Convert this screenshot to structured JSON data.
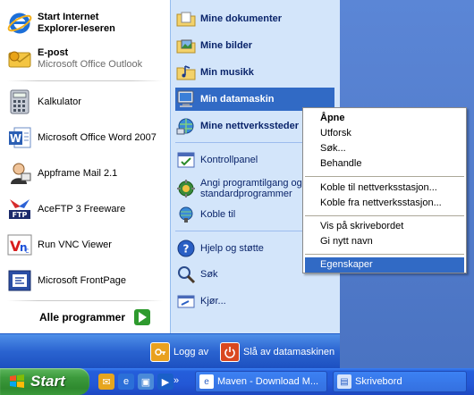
{
  "pinned": [
    {
      "name": "Start Internet Explorer-leseren",
      "line1": "Start Internet",
      "line2": "Explorer-leseren",
      "icon": "internet-explorer-icon"
    },
    {
      "name": "E-post",
      "line1": "E-post",
      "line2": "Microsoft Office Outlook",
      "icon": "outlook-icon"
    }
  ],
  "recent": [
    {
      "label": "Kalkulator",
      "icon": "calculator-icon"
    },
    {
      "label": "Microsoft Office Word 2007",
      "icon": "word-icon"
    },
    {
      "label": "Appframe Mail 2.1",
      "icon": "appframe-mail-icon"
    },
    {
      "label": "AceFTP 3 Freeware",
      "icon": "aceftp-icon"
    },
    {
      "label": "Run VNC Viewer",
      "icon": "vnc-icon"
    },
    {
      "label": "Microsoft FrontPage",
      "icon": "frontpage-icon"
    }
  ],
  "all_programs": "Alle programmer",
  "places": [
    {
      "label": "Mine dokumenter",
      "icon": "my-documents-icon"
    },
    {
      "label": "Mine bilder",
      "icon": "my-pictures-icon"
    },
    {
      "label": "Min musikk",
      "icon": "my-music-icon"
    },
    {
      "label": "Min datamaskin",
      "icon": "my-computer-icon"
    },
    {
      "label": "Mine nettverkssteder",
      "icon": "my-network-icon"
    }
  ],
  "settings": [
    {
      "label": "Kontrollpanel",
      "icon": "control-panel-icon"
    },
    {
      "line1": "Angi programtilgang og",
      "line2": "standardprogrammer",
      "icon": "program-access-icon"
    },
    {
      "label": "Koble til",
      "icon": "connect-to-icon"
    }
  ],
  "tools": [
    {
      "label": "Hjelp og støtte",
      "icon": "help-icon"
    },
    {
      "label": "Søk",
      "icon": "search-icon"
    },
    {
      "label": "Kjør...",
      "icon": "run-icon"
    }
  ],
  "logoff": "Logg av",
  "shutdown": "Slå av datamaskinen",
  "context_menu": {
    "groups": [
      [
        "Åpne",
        "Utforsk",
        "Søk...",
        "Behandle"
      ],
      [
        "Koble til nettverksstasjon...",
        "Koble fra nettverksstasjon..."
      ],
      [
        "Vis på skrivebordet",
        "Gi nytt navn"
      ],
      [
        "Egenskaper"
      ]
    ],
    "default_item": "Åpne",
    "selected_item": "Egenskaper"
  },
  "taskbar": {
    "start": "Start",
    "windows": [
      "Maven - Download M...",
      "Skrivebord"
    ]
  },
  "colors": {
    "selection": "#316ac5",
    "right_pane": "#d3e5fa",
    "taskbar": "#245edb",
    "start_button": "#3c9a3c"
  }
}
